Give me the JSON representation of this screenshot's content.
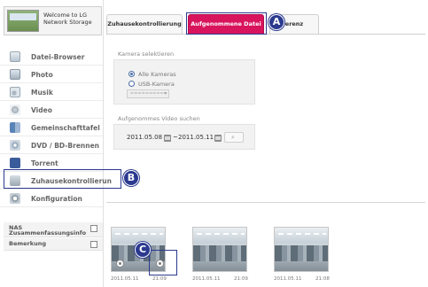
{
  "brand": {
    "title": "Welcome to LG Network Storage"
  },
  "sidebar": {
    "items": [
      {
        "label": "Datei-Browser",
        "icon": "document-icon"
      },
      {
        "label": "Photo",
        "icon": "photo-icon"
      },
      {
        "label": "Musik",
        "icon": "music-icon"
      },
      {
        "label": "Video",
        "icon": "video-icon"
      },
      {
        "label": "Gemeinschafttafel",
        "icon": "shared-board-icon"
      },
      {
        "label": "DVD / BD-Brennen",
        "icon": "disc-icon"
      },
      {
        "label": "Torrent",
        "icon": "torrent-icon"
      },
      {
        "label": "Zuhausekontrollierun",
        "icon": "home-camera-icon"
      },
      {
        "label": "Konfiguration",
        "icon": "gear-icon"
      }
    ],
    "lower": [
      {
        "label": "NAS\nZusammenfassungsinfo"
      },
      {
        "label": "Bemerkung"
      }
    ]
  },
  "tabs": [
    {
      "label": "Zuhausekontrollierung"
    },
    {
      "label": "Aufgenommene Datei"
    },
    {
      "label": "erenz"
    }
  ],
  "camera": {
    "section_label": "Kamera selektieren",
    "options": [
      {
        "label": "Alle Kameras",
        "checked": true
      },
      {
        "label": "USB-Kamera",
        "checked": false
      }
    ],
    "select_value": "=========="
  },
  "search": {
    "section_label": "Aufgenommes Video suchen",
    "date_from": "2011.05.08",
    "date_sep": "~",
    "date_to": "2011.05.11"
  },
  "thumbnails": [
    {
      "date": "2011.05.11",
      "time": "21:09"
    },
    {
      "date": "2011.05.11",
      "time": "21:09"
    },
    {
      "date": "2011.05.11",
      "time": "21:08"
    }
  ],
  "callouts": {
    "a": "A",
    "b": "B",
    "c": "C"
  },
  "colors": {
    "active_tab": "#d8145d",
    "callout": "#2b3a8f"
  }
}
